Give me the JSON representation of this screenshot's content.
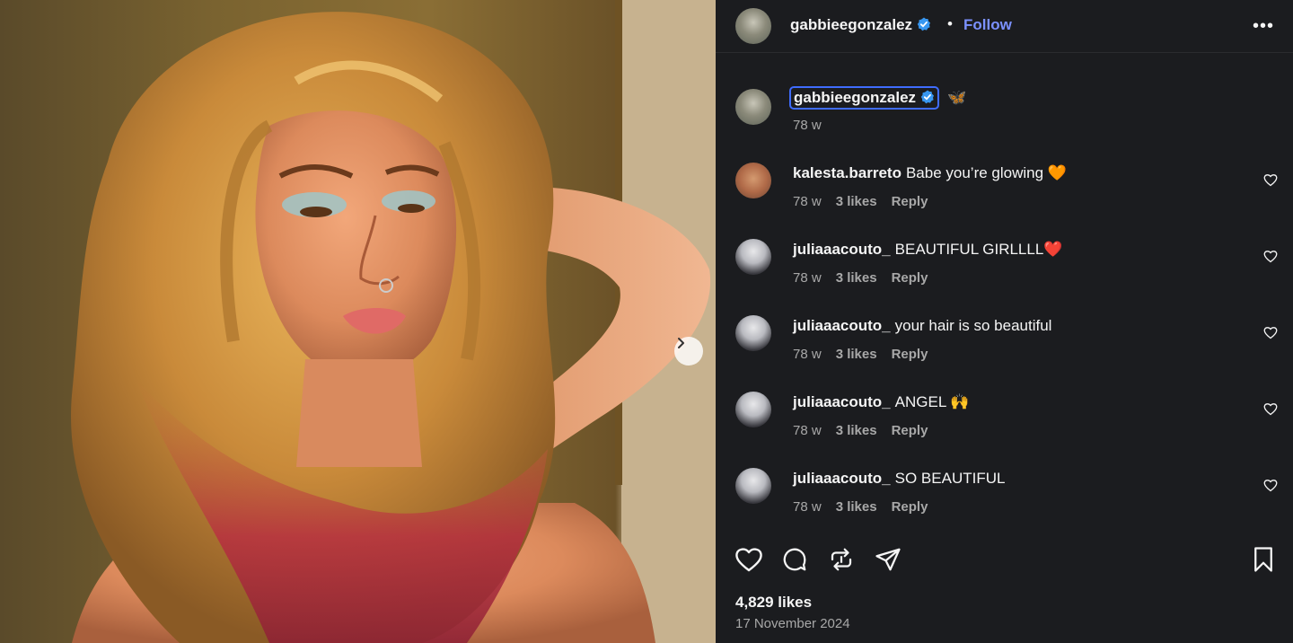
{
  "post": {
    "author": "gabbieegonzalez",
    "follow_label": "Follow",
    "separator": "•",
    "more_label": "•••",
    "caption_emoji": "🦋",
    "caption_age": "78 w",
    "likes": "4,829 likes",
    "date": "17 November 2024"
  },
  "comments": [
    {
      "user": "kalesta.barreto",
      "text": "Babe you’re glowing 🧡",
      "age": "78 w",
      "likes": "3 likes",
      "reply": "Reply"
    },
    {
      "user": "juliaaacouto_",
      "text": "BEAUTIFUL GIRLLLL❤️",
      "age": "78 w",
      "likes": "3 likes",
      "reply": "Reply"
    },
    {
      "user": "juliaaacouto_",
      "text": "your hair is so beautiful",
      "age": "78 w",
      "likes": "3 likes",
      "reply": "Reply"
    },
    {
      "user": "juliaaacouto_",
      "text": "ANGEL 🙌",
      "age": "78 w",
      "likes": "3 likes",
      "reply": "Reply"
    },
    {
      "user": "juliaaacouto_",
      "text": "SO BEAUTIFUL",
      "age": "78 w",
      "likes": "3 likes",
      "reply": "Reply"
    }
  ],
  "icons": {
    "verified": "verified-badge-icon",
    "next": "chevron-right-icon",
    "more": "more-options-icon",
    "like": "heart-icon",
    "comment": "comment-icon",
    "repost": "repost-icon",
    "share": "share-icon",
    "save": "bookmark-icon"
  },
  "colors": {
    "background": "#1b1c1f",
    "follow": "#7b91ff",
    "verified": "#3897f0",
    "muted_text": "#a8a8a8"
  }
}
